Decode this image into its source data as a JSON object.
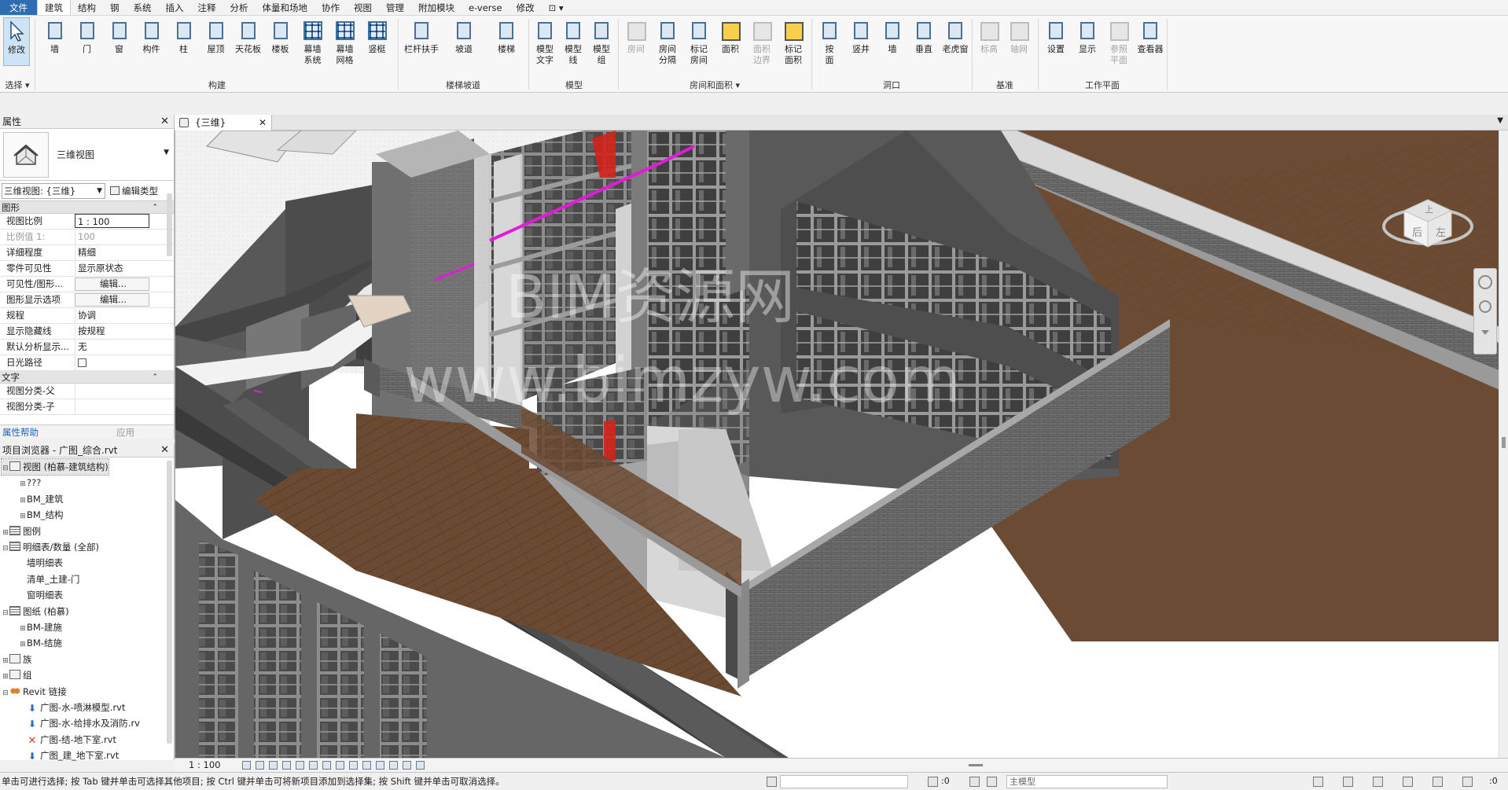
{
  "menu": {
    "tabs": [
      {
        "label": "文件",
        "kind": "file"
      },
      {
        "label": "建筑",
        "kind": "active"
      },
      {
        "label": "结构"
      },
      {
        "label": "钢"
      },
      {
        "label": "系统"
      },
      {
        "label": "插入"
      },
      {
        "label": "注释"
      },
      {
        "label": "分析"
      },
      {
        "label": "体量和场地"
      },
      {
        "label": "协作"
      },
      {
        "label": "视图"
      },
      {
        "label": "管理"
      },
      {
        "label": "附加模块"
      },
      {
        "label": "e-verse"
      },
      {
        "label": "修改"
      },
      {
        "label": "⊡ ▾"
      }
    ]
  },
  "ribbon": {
    "select": {
      "modify": "修改",
      "select_label": "选择 ▾"
    },
    "build": {
      "title": "构建",
      "tools": [
        "墙",
        "门",
        "窗",
        "构件",
        "柱",
        "屋顶",
        "天花板",
        "楼板",
        "幕墙\n系统",
        "幕墙\n网格",
        "竖梃"
      ]
    },
    "circulation": {
      "title": "楼梯坡道",
      "tools": [
        "栏杆扶手",
        "坡道",
        "楼梯"
      ]
    },
    "model": {
      "title": "模型",
      "tools": [
        "模型\n文字",
        "模型\n线",
        "模型\n组"
      ]
    },
    "room": {
      "title": "房间和面积 ▾",
      "tools": [
        "房间",
        "房间\n分隔",
        "标记\n房间",
        "面积",
        "面积\n边界",
        "标记\n面积"
      ]
    },
    "opening": {
      "title": "洞口",
      "tools": [
        "按\n面",
        "竖井",
        "墙",
        "垂直",
        "老虎窗"
      ]
    },
    "datum": {
      "title": "基准",
      "tools": [
        "标高",
        "轴网"
      ]
    },
    "workplane": {
      "title": "工作平面",
      "tools": [
        "设置",
        "显示",
        "参照\n平面",
        "查看器"
      ]
    }
  },
  "properties": {
    "title": "属性",
    "type_name": "三维视图",
    "selector": "三维视图: {三维}",
    "edit_type": "编辑类型",
    "group_graphics": "图形",
    "rows": [
      {
        "k": "视图比例",
        "v": "1 : 100",
        "style": "boxed"
      },
      {
        "k": "比例值 1:",
        "v": "100",
        "style": "gray"
      },
      {
        "k": "详细程度",
        "v": "精细"
      },
      {
        "k": "零件可见性",
        "v": "显示原状态"
      },
      {
        "k": "可见性/图形...",
        "v": "编辑...",
        "style": "btn"
      },
      {
        "k": "图形显示选项",
        "v": "编辑...",
        "style": "btn"
      },
      {
        "k": "规程",
        "v": "协调"
      },
      {
        "k": "显示隐藏线",
        "v": "按规程"
      },
      {
        "k": "默认分析显示...",
        "v": "无"
      },
      {
        "k": "日光路径",
        "v": "",
        "style": "check"
      }
    ],
    "group_text": "文字",
    "rows2": [
      {
        "k": "视图分类-父",
        "v": ""
      },
      {
        "k": "视图分类-子",
        "v": ""
      }
    ],
    "help": "属性帮助",
    "apply": "应用"
  },
  "browser": {
    "title": "项目浏览器 - 广图_综合.rvt",
    "items": [
      {
        "lvl": 0,
        "tg": "⊟",
        "icon": "view",
        "label": "视图 (柏慕-建筑结构)",
        "sel": true
      },
      {
        "lvl": 1,
        "tg": "⊞",
        "icon": "",
        "label": "???"
      },
      {
        "lvl": 1,
        "tg": "⊞",
        "icon": "",
        "label": "BM_建筑"
      },
      {
        "lvl": 1,
        "tg": "⊞",
        "icon": "",
        "label": "BM_结构"
      },
      {
        "lvl": 0,
        "tg": "⊞",
        "icon": "sheet",
        "label": "图例"
      },
      {
        "lvl": 0,
        "tg": "⊟",
        "icon": "sheet",
        "label": "明细表/数量 (全部)"
      },
      {
        "lvl": 1,
        "tg": "",
        "icon": "",
        "label": "墙明细表"
      },
      {
        "lvl": 1,
        "tg": "",
        "icon": "",
        "label": "清单_土建-门"
      },
      {
        "lvl": 1,
        "tg": "",
        "icon": "",
        "label": "窗明细表"
      },
      {
        "lvl": 0,
        "tg": "⊟",
        "icon": "sheet",
        "label": "图纸 (柏慕)"
      },
      {
        "lvl": 1,
        "tg": "⊞",
        "icon": "",
        "label": "BM-建施"
      },
      {
        "lvl": 1,
        "tg": "⊞",
        "icon": "",
        "label": "BM-结施"
      },
      {
        "lvl": 0,
        "tg": "⊞",
        "icon": "view",
        "label": "族"
      },
      {
        "lvl": 0,
        "tg": "⊞",
        "icon": "view",
        "label": "组"
      },
      {
        "lvl": 0,
        "tg": "⊟",
        "icon": "link",
        "label": "Revit 链接"
      },
      {
        "lvl": 1,
        "tg": "",
        "icon": "arrow",
        "label": "广图-水-喷淋模型.rvt"
      },
      {
        "lvl": 1,
        "tg": "",
        "icon": "arrow",
        "label": "广图-水-给排水及消防.rv"
      },
      {
        "lvl": 1,
        "tg": "",
        "icon": "x",
        "label": "广图-结-地下室.rvt"
      },
      {
        "lvl": 1,
        "tg": "",
        "icon": "arrow",
        "label": "广图_建_地下室.rvt"
      }
    ]
  },
  "view": {
    "tab_label": "{三维}",
    "watermark1": "BIM资源网",
    "watermark2": "www.bimzyw.com",
    "cube_left": "后",
    "cube_right": "左",
    "cube_top": "上"
  },
  "viewbar": {
    "scale": "1 : 100"
  },
  "status": {
    "message": "单击可进行选择; 按 Tab 键并单击可选择其他项目; 按 Ctrl 键并单击可将新项目添加到选择集; 按 Shift 键并单击可取消选择。",
    "count1": ":0",
    "model": "主模型",
    "filter_count": ":0"
  },
  "colors": {
    "accent": "#2f6db3",
    "floor": "#6b4a32",
    "wall": "#5b5b5b",
    "brick": "#6f6f6f",
    "glass": "#3c3c3c",
    "magenta": "#e21bd8",
    "red": "#d3221b"
  }
}
